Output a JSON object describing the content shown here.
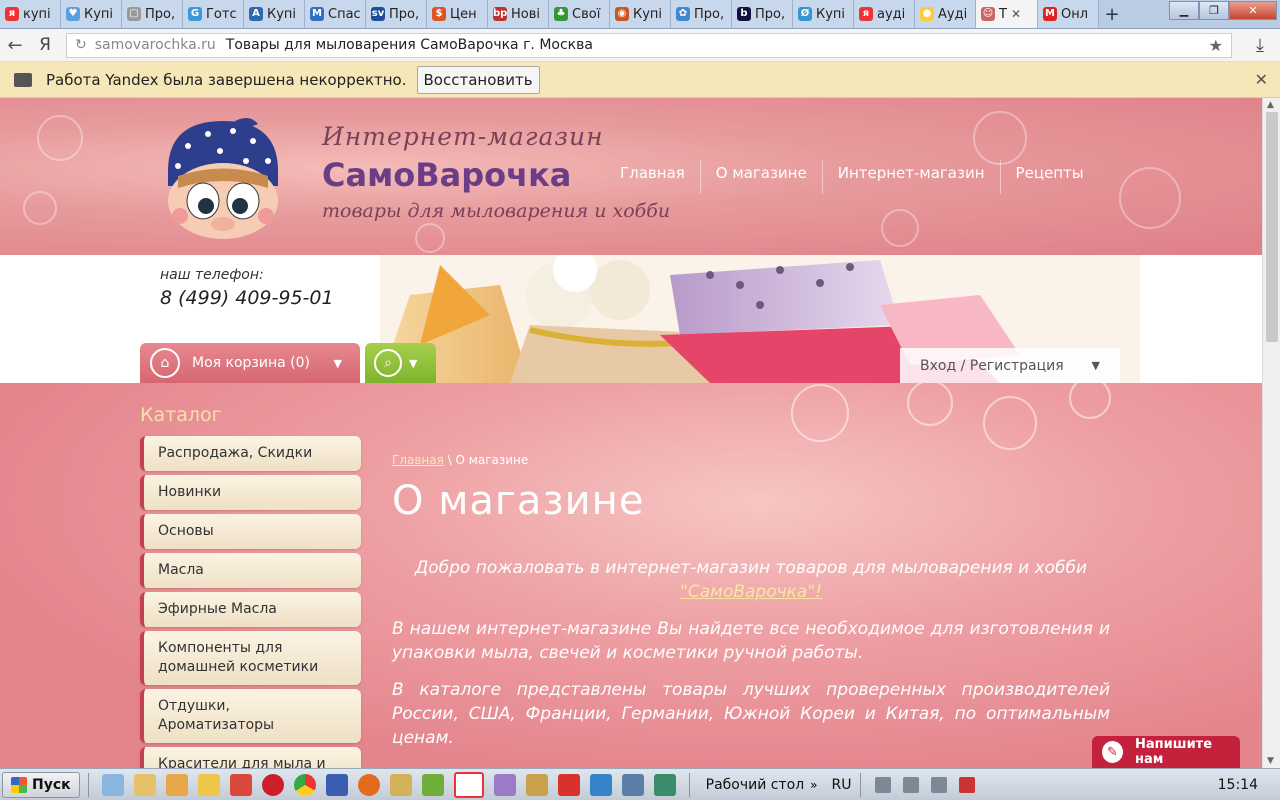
{
  "browser": {
    "tabs": [
      {
        "label": "купі",
        "fav": "я",
        "color": "#e33"
      },
      {
        "label": "Купі",
        "fav": "♥",
        "color": "#5aa0e0"
      },
      {
        "label": "Про,",
        "fav": "▢",
        "color": "#999"
      },
      {
        "label": "Готс",
        "fav": "G",
        "color": "#3a9ad9"
      },
      {
        "label": "Купі",
        "fav": "A",
        "color": "#2b6ab0"
      },
      {
        "label": "Спас",
        "fav": "M",
        "color": "#3170c0"
      },
      {
        "label": "Про,",
        "fav": "sv",
        "color": "#1c4e9b"
      },
      {
        "label": "Цен",
        "fav": "$",
        "color": "#d52"
      },
      {
        "label": "Нові",
        "fav": "bp",
        "color": "#b33"
      },
      {
        "label": "Свої",
        "fav": "♣",
        "color": "#393"
      },
      {
        "label": "Купі",
        "fav": "◉",
        "color": "#c52"
      },
      {
        "label": "Про,",
        "fav": "✿",
        "color": "#48c"
      },
      {
        "label": "Про,",
        "fav": "b",
        "color": "#114"
      },
      {
        "label": "Купі",
        "fav": "Ø",
        "color": "#39c"
      },
      {
        "label": "ауді",
        "fav": "я",
        "color": "#e33"
      },
      {
        "label": "Ауді",
        "fav": "●",
        "color": "#fc3"
      },
      {
        "label": "Т",
        "fav": "☺",
        "color": "#c66",
        "active": true
      },
      {
        "label": "Онл",
        "fav": "M",
        "color": "#d22"
      }
    ],
    "newtab": "+",
    "url_host": "samovarochka.ru",
    "page_title": "Товары для мыловарения СамоВарочка г. Москва",
    "yandex_letter": "Я"
  },
  "infobar": {
    "message": "Работа Yandex была завершена некорректно.",
    "restore_label": "Восстановить",
    "close": "✕"
  },
  "site": {
    "logo_top": "Интернет-магазин",
    "logo_main": "СамоВарочка",
    "logo_sub": "товары для мыловарения и хобби",
    "nav": [
      "Главная",
      "О магазине",
      "Интернет-магазин",
      "Рецепты"
    ],
    "phone_label": "наш телефон:",
    "phone": "8 (499) 409-95-01",
    "cart_label": "Моя корзина (0)",
    "login_label": "Вход / Регистрация",
    "catalog_title": "Каталог",
    "catalog": [
      "Распродажа, Скидки",
      "Новинки",
      "Основы",
      "Масла",
      "Эфирные Масла",
      "Компоненты для домашней косметики",
      "Отдушки, Ароматизаторы",
      "Красители для мыла и"
    ],
    "breadcrumb_home": "Главная",
    "breadcrumb_sep": "\\",
    "breadcrumb_current": "О магазине",
    "title": "О магазине",
    "para1_a": "Добро пожаловать в интернет-магазин товаров для мыловарения и хобби",
    "para1_link": "\"СамоВарочка\"!",
    "para2": "В нашем интернет-магазине Вы найдете  все необходимое для изготовления  и упаковки мыла, свечей и косметики ручной работы.",
    "para3": "В  каталоге представлены товары лучших проверенных производителей России, США, Франции, Германии, Южной Кореи и Китая, по оптимальным ценам.",
    "chat_label": "Напишите нам"
  },
  "taskbar": {
    "start": "Пуск",
    "desktop": "Рабочий стол",
    "lang": "RU",
    "time": "15:14"
  }
}
